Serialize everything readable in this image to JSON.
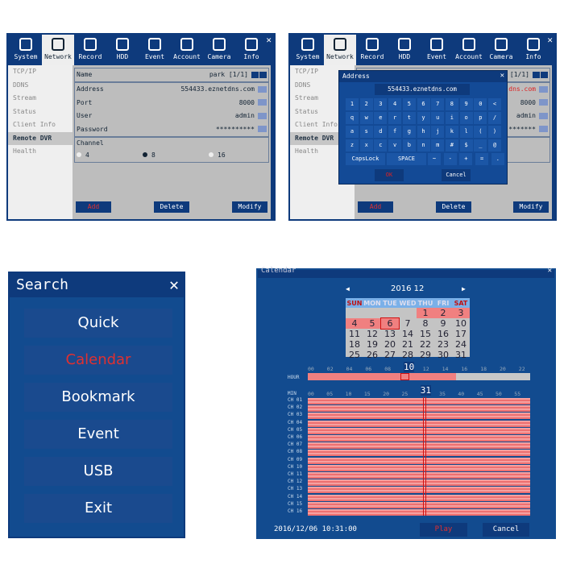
{
  "network_panel": {
    "tabs": [
      "System",
      "Network",
      "Record",
      "HDD",
      "Event",
      "Account",
      "Camera",
      "Info"
    ],
    "selected_tab": "Network",
    "sidebar": [
      "TCP/IP",
      "DDNS",
      "Stream",
      "Status",
      "Client Info",
      "Remote DVR",
      "Health"
    ],
    "selected_side": "Remote DVR",
    "fields": [
      {
        "label": "Name",
        "value": "park [1/1]"
      },
      {
        "label": "Address",
        "value": "554433.eznetdns.com"
      },
      {
        "label": "Port",
        "value": "8000"
      },
      {
        "label": "User",
        "value": "admin"
      },
      {
        "label": "Password",
        "value": "**********"
      }
    ],
    "channel_label": "Channel",
    "channel_options": [
      "4",
      "8",
      "16"
    ],
    "channel_selected": "8",
    "buttons": {
      "add": "Add",
      "delete": "Delete",
      "modify": "Modify"
    }
  },
  "keyboard_dialog": {
    "title": "Address",
    "value": "554433.eznetdns.com",
    "rows": [
      [
        "1",
        "2",
        "3",
        "4",
        "5",
        "6",
        "7",
        "8",
        "9",
        "0",
        "<"
      ],
      [
        "q",
        "w",
        "e",
        "r",
        "t",
        "y",
        "u",
        "i",
        "o",
        "p",
        "/"
      ],
      [
        "a",
        "s",
        "d",
        "f",
        "g",
        "h",
        "j",
        "k",
        "l",
        "(",
        ")"
      ],
      [
        "z",
        "x",
        "c",
        "v",
        "b",
        "n",
        "m",
        "#",
        "$",
        "_",
        "@"
      ]
    ],
    "last_row": [
      "CapsLock",
      "SPACE",
      "~",
      "-",
      "+",
      "=",
      "."
    ],
    "ok": "OK",
    "cancel": "Cancel",
    "bg_field_values": [
      "dns.com",
      "8000",
      "admin",
      "*******"
    ]
  },
  "search_menu": {
    "title": "Search",
    "items": [
      "Quick",
      "Calendar",
      "Bookmark",
      "Event",
      "USB",
      "Exit"
    ],
    "highlighted": "Calendar"
  },
  "calendar": {
    "title": "Calendar",
    "month_label": "2016 12",
    "weekdays": [
      "SUN",
      "MON",
      "TUE",
      "WED",
      "THU",
      "FRI",
      "SAT"
    ],
    "first_weekday": 4,
    "days": 31,
    "recorded_days": [
      1,
      2,
      3,
      4,
      5,
      6
    ],
    "selected_day": 6,
    "hour_label": "HOUR",
    "hour_ticks": [
      "00",
      "02",
      "04",
      "06",
      "08",
      "10",
      "12",
      "14",
      "16",
      "18",
      "20",
      "22"
    ],
    "selected_hour": "10",
    "recorded_hours_until": 15,
    "min_label": "MIN",
    "min_ticks": [
      "00",
      "05",
      "10",
      "15",
      "20",
      "25",
      "31",
      "35",
      "40",
      "45",
      "50",
      "55"
    ],
    "selected_minute": "31",
    "channels": [
      "CH 01",
      "CH 02",
      "CH 03",
      "CH 04",
      "CH 05",
      "CH 06",
      "CH 07",
      "CH 08",
      "CH 09",
      "CH 10",
      "CH 11",
      "CH 12",
      "CH 13",
      "CH 14",
      "CH 15",
      "CH 16"
    ],
    "datetime": "2016/12/06 10:31:00",
    "play": "Play",
    "cancel": "Cancel"
  },
  "colors": {
    "dark_blue": "#0e3a7c",
    "panel_blue": "#124b8f",
    "record_red": "#f08080",
    "highlight_red": "#e03030"
  }
}
